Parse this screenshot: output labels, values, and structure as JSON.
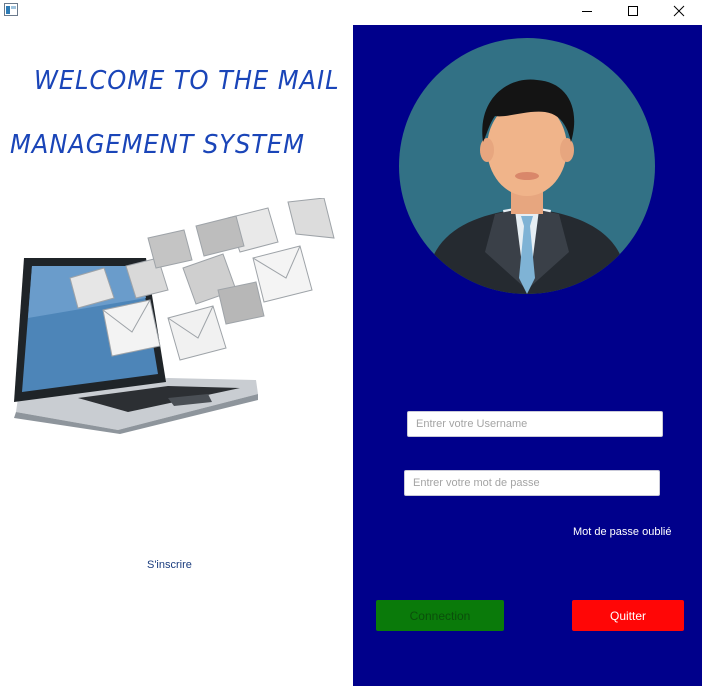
{
  "window": {
    "controls": {
      "minimize": "minimize-icon",
      "maximize": "maximize-icon",
      "close": "close-icon"
    }
  },
  "left_panel": {
    "welcome_line1": "WELCOME TO THE MAIL",
    "welcome_line2": "MANAGEMENT SYSTEM",
    "image": "laptop-with-flying-envelopes",
    "signup_link": "S'inscrire"
  },
  "right_panel": {
    "background_color": "#00008b",
    "avatar": "user-avatar",
    "username_placeholder": "Entrer votre Username",
    "password_placeholder": "Entrer votre mot de passe",
    "forgot_password": "Mot de passe oublié",
    "connect_button": "Connection",
    "quit_button": "Quitter",
    "connect_color": "#0a7a0a",
    "quit_color": "#ff0606"
  }
}
